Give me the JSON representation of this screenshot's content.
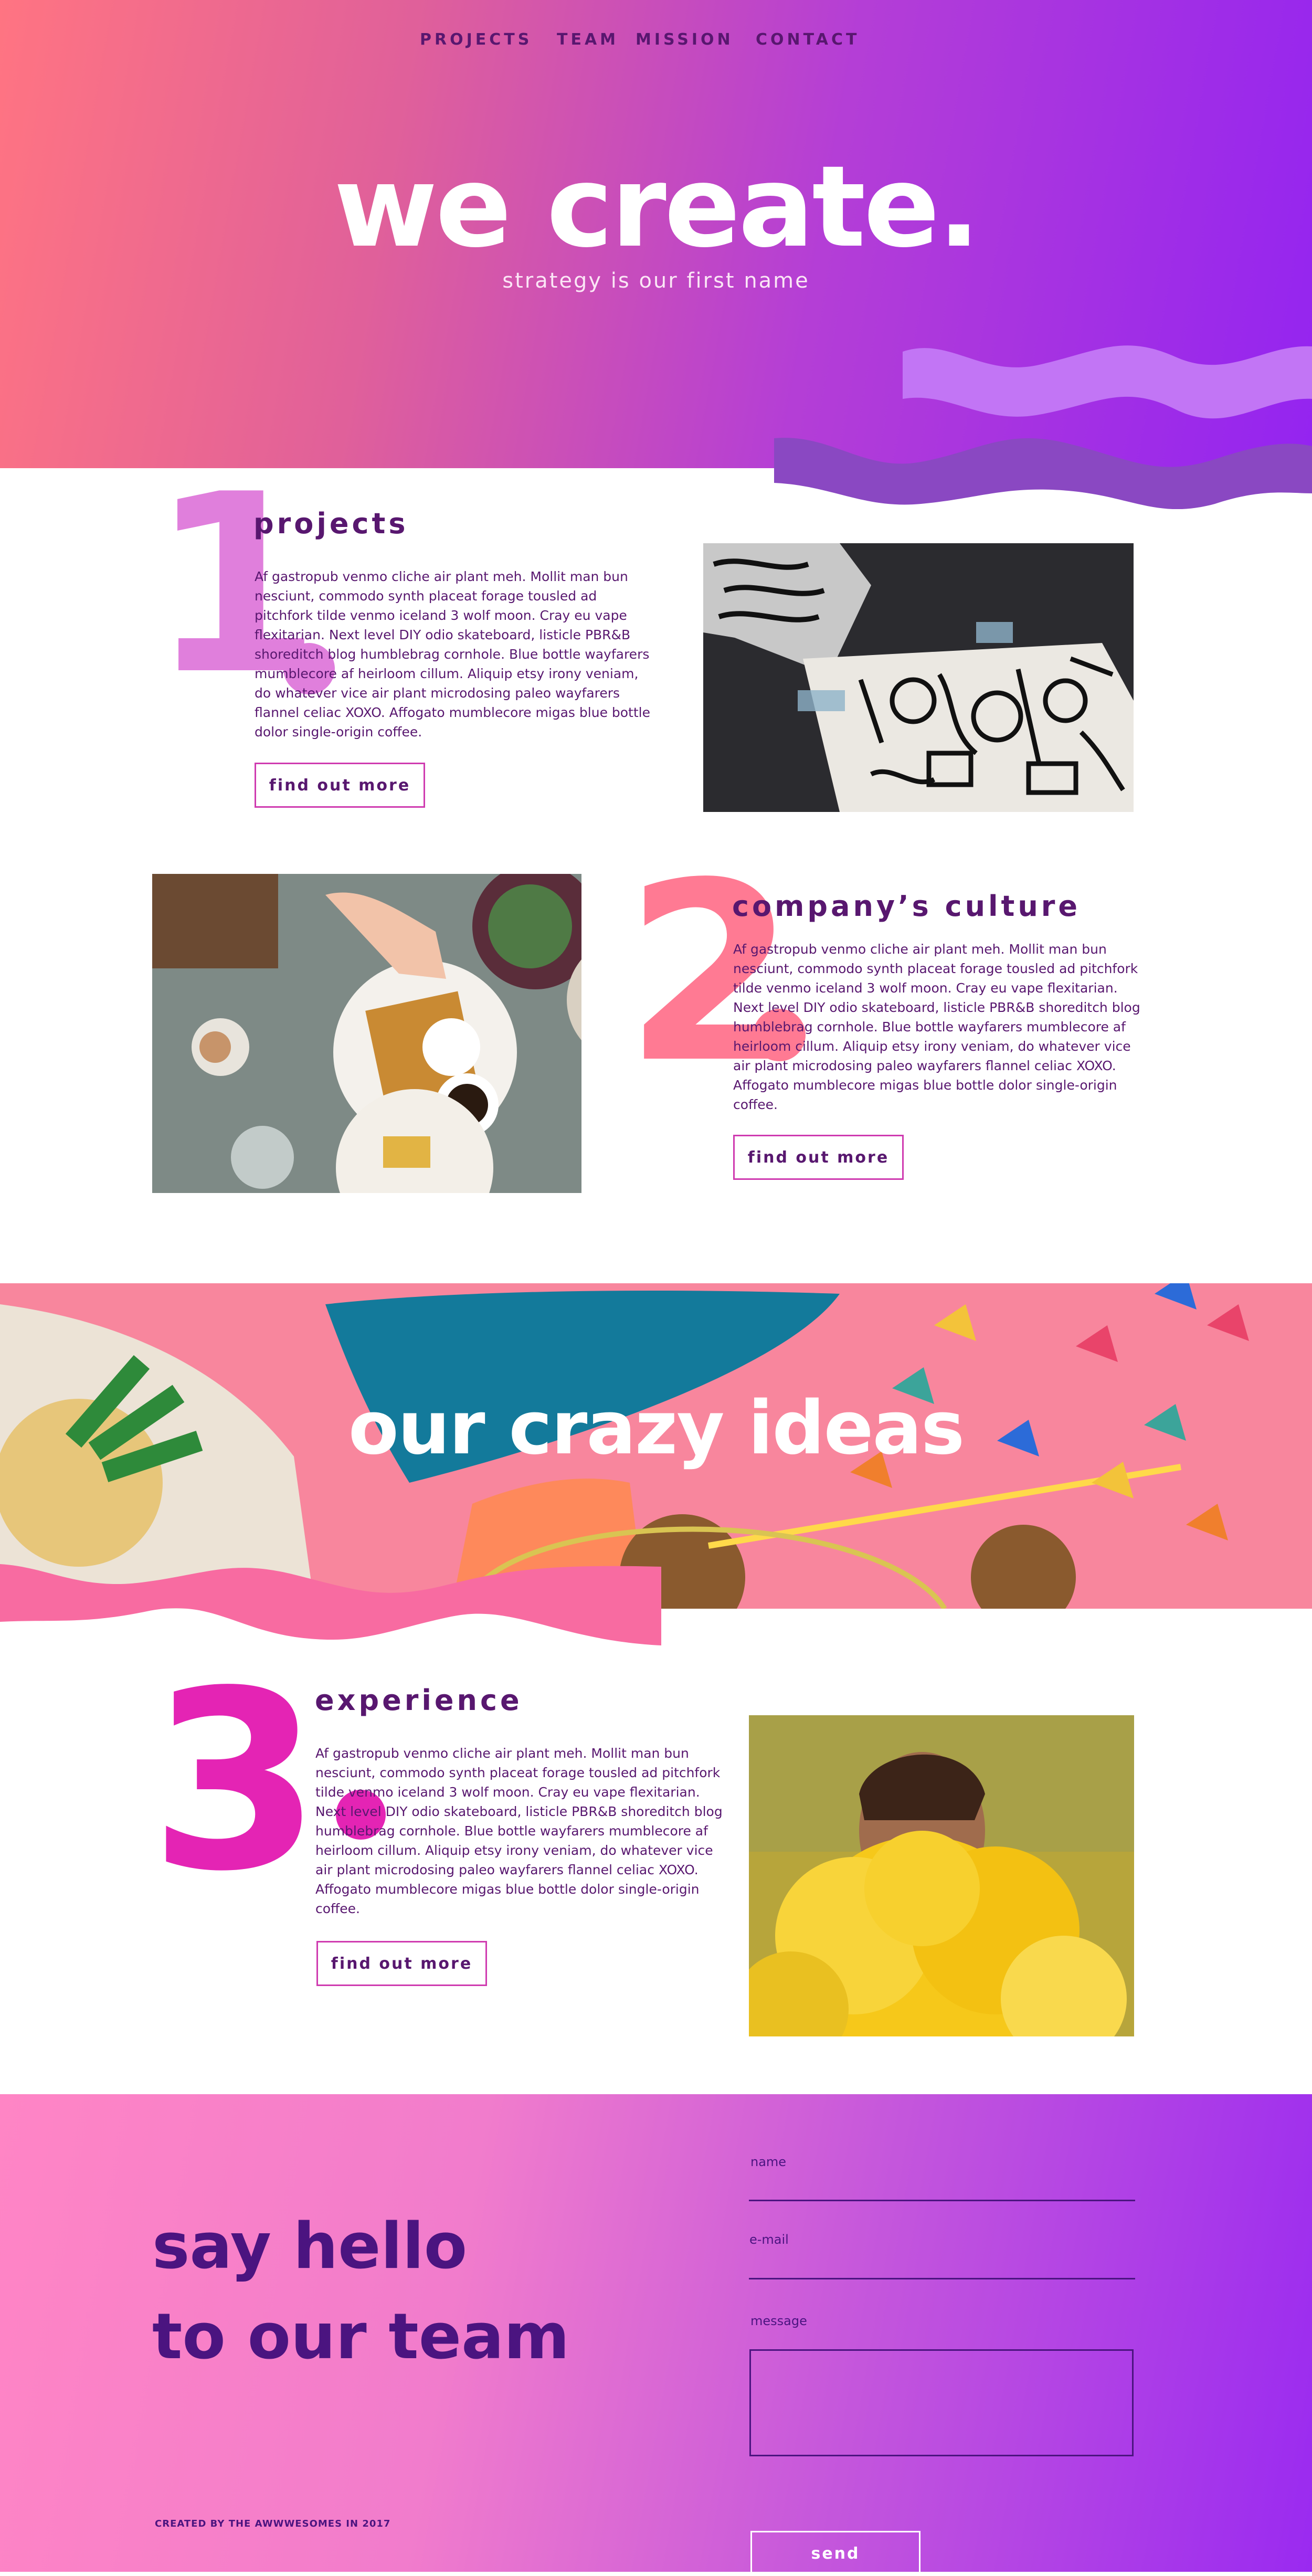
{
  "nav": {
    "items": [
      {
        "label": "PROJECTS"
      },
      {
        "label": "TEAM"
      },
      {
        "label": "MISSION"
      },
      {
        "label": "CONTACT"
      }
    ]
  },
  "hero": {
    "title": "we create.",
    "subtitle": "strategy is our first name"
  },
  "sections": [
    {
      "number": "1",
      "title": "projects",
      "body": "Af gastropub venmo cliche air plant meh. Mollit man bun nesciunt, commodo synth placeat forage tousled ad pitchfork tilde venmo iceland 3 wolf moon. Cray eu vape flexitarian. Next level DIY odio skateboard, listicle PBR&B shoreditch blog humblebrag cornhole. Blue bottle wayfarers mumblecore af heirloom cillum. Aliquip etsy irony veniam, do whatever vice air plant microdosing paleo wayfarers flannel celiac XOXO. Affogato mumblecore migas blue bottle dolor single-origin coffee.",
      "button": "find out more",
      "image": "street-art-drawing-photo"
    },
    {
      "number": "2",
      "title": "company’s culture",
      "body": "Af gastropub venmo cliche air plant meh. Mollit man bun nesciunt, commodo synth placeat forage tousled ad pitchfork tilde venmo iceland 3 wolf moon. Cray eu vape flexitarian. Next level DIY odio skateboard, listicle PBR&B shoreditch blog humblebrag cornhole. Blue bottle wayfarers mumblecore af heirloom cillum. Aliquip etsy irony veniam, do whatever vice air plant microdosing paleo wayfarers flannel celiac XOXO. Affogato mumblecore migas blue bottle dolor single-origin coffee.",
      "button": "find out more",
      "image": "brunch-waffles-photo"
    },
    {
      "number": "3",
      "title": "experience",
      "body": "Af gastropub venmo cliche air plant meh. Mollit man bun nesciunt, commodo synth placeat forage tousled ad pitchfork tilde venmo iceland 3 wolf moon. Cray eu vape flexitarian. Next level DIY odio skateboard, listicle PBR&B shoreditch blog humblebrag cornhole. Blue bottle wayfarers mumblecore af heirloom cillum. Aliquip etsy irony veniam, do whatever vice air plant microdosing paleo wayfarers flannel celiac XOXO. Affogato mumblecore migas blue bottle dolor single-origin coffee.",
      "button": "find out more",
      "image": "yellow-smoke-portrait-photo"
    }
  ],
  "ideas": {
    "title": "our crazy ideas",
    "image": "pineapple-bag-cocktail-umbrellas-photo"
  },
  "contact": {
    "heading_line1": "say hello",
    "heading_line2": "to our team",
    "name_label": "name",
    "email_label": "e-mail",
    "message_label": "message",
    "send_label": "send",
    "credit": "CREATED BY THE AWWWESOMES IN 2017"
  },
  "colors": {
    "deep_purple": "#4b1480",
    "pink_number": "#ff7a93",
    "magenta_number": "#e424b4",
    "lavender_number": "#e07fdc",
    "hero_gradient_start": "#ff7482",
    "hero_gradient_end": "#9424f0"
  }
}
